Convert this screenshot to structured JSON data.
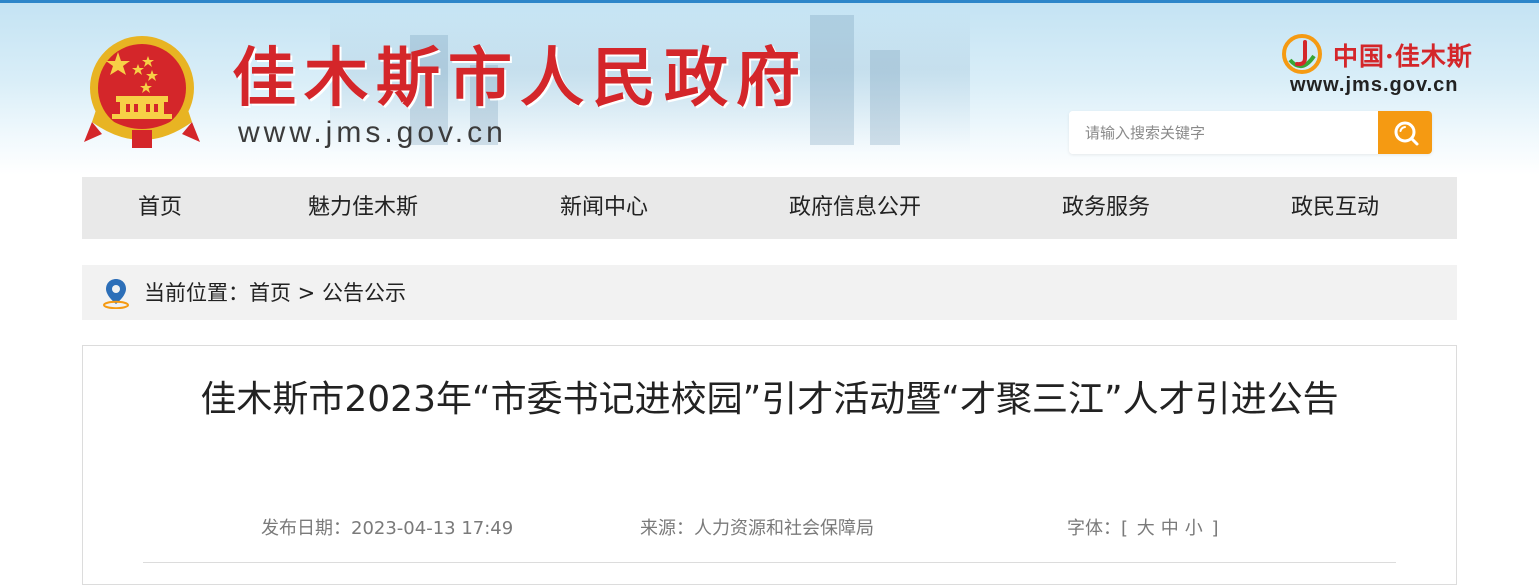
{
  "header": {
    "site_title": "佳木斯市人民政府",
    "site_url": "www.jms.gov.cn",
    "brand_text": "中国·佳木斯",
    "brand_url": "www.jms.gov.cn",
    "search_placeholder": "请输入搜索关键字",
    "search_value": ""
  },
  "nav": {
    "items": [
      {
        "label": "首页"
      },
      {
        "label": "魅力佳木斯"
      },
      {
        "label": "新闻中心"
      },
      {
        "label": "政府信息公开"
      },
      {
        "label": "政务服务"
      },
      {
        "label": "政民互动"
      }
    ]
  },
  "breadcrumb": {
    "prefix": "当前位置：",
    "home": "首页",
    "separator": " > ",
    "current": "公告公示"
  },
  "article": {
    "title": "佳木斯市2023年“市委书记进校园”引才活动暨“才聚三江”人才引进公告",
    "publish_label": "发布日期：",
    "publish_date": "2023-04-13 17:49",
    "source_label": "来源：",
    "source": "人力资源和社会保障局",
    "font_label": "字体：",
    "font_open": "[",
    "font_large": "大",
    "font_medium": "中",
    "font_small": "小",
    "font_close": "]"
  },
  "colors": {
    "title_red": "#d4262a",
    "search_orange": "#f59a12",
    "nav_bg": "#e9e9e9",
    "header_blue": "#2d86c9"
  },
  "icons": {
    "emblem": "national-emblem-icon",
    "brand": "jms-brand-logo-icon",
    "search": "search-icon",
    "location": "location-pin-icon"
  }
}
